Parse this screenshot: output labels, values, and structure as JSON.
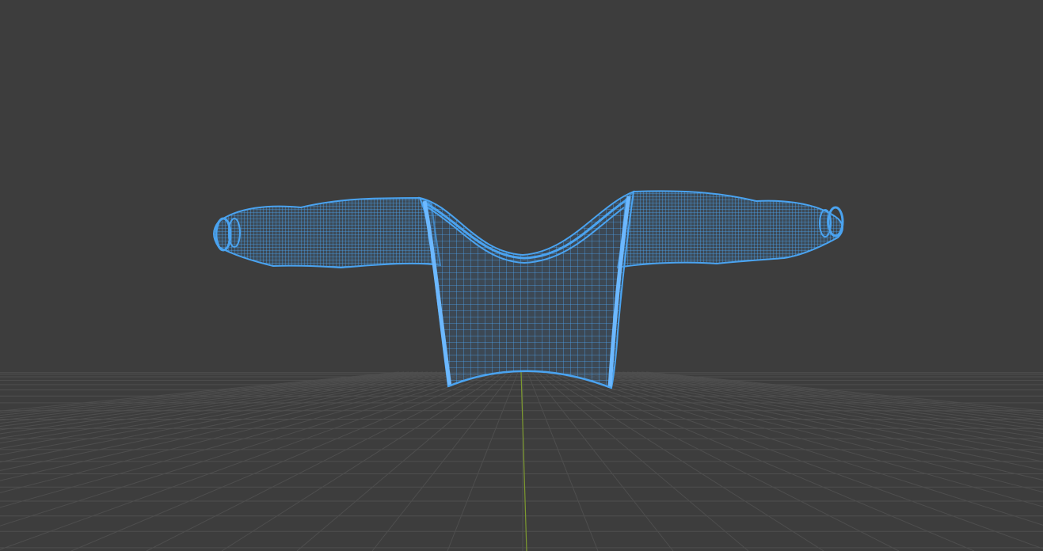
{
  "viewport": {
    "background_color": "#3d3d3d",
    "grid_line_color": "#4e4e4e",
    "y_axis_color": "#7d9a2f",
    "mesh_wire_color": "#4aa3f0",
    "mesh_fill_color": "#3b5a78",
    "display_mode": "wireframe"
  }
}
